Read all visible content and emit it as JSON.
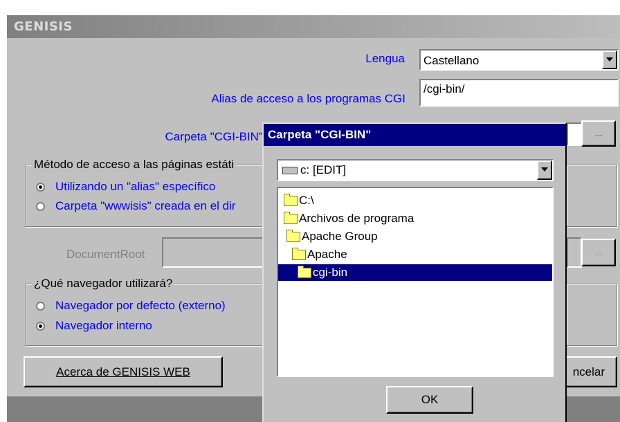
{
  "main_window": {
    "title": "GENISIS",
    "language_label": "Lengua",
    "language_value": "Castellano",
    "cgi_alias_label": "Alias de acceso a los programas CGI",
    "cgi_alias_value": "/cgi-bin/",
    "cgi_folder_label": "Carpeta \"CGI-BIN\"",
    "browse_button": "...",
    "access_group": {
      "legend": "Método de acceso a las páginas estáti",
      "options": [
        "Utilizando un \"alias\" específico",
        "Carpeta \"wwwisis\" creada en el dir"
      ],
      "selected": 0
    },
    "document_root_label": "DocumentRoot",
    "document_root_browse": "...",
    "browser_group": {
      "legend": "¿Qué navegador utilizará?",
      "options": [
        "Navegador por defecto (externo)",
        "Navegador interno"
      ],
      "selected": 1
    },
    "about_button": "Acerca de GENISIS WEB",
    "cancel_button_partial": "ncelar"
  },
  "dialog": {
    "title": "Carpeta \"CGI-BIN\"",
    "drive_value": "c: [EDIT]",
    "tree": [
      {
        "label": "C:\\",
        "level": 0,
        "selected": false
      },
      {
        "label": "Archivos de programa",
        "level": 0,
        "selected": false
      },
      {
        "label": "Apache Group",
        "level": 1,
        "selected": false
      },
      {
        "label": "Apache",
        "level": 1,
        "selected": false
      },
      {
        "label": "cgi-bin",
        "level": 2,
        "selected": true
      }
    ],
    "ok_button": "OK"
  }
}
